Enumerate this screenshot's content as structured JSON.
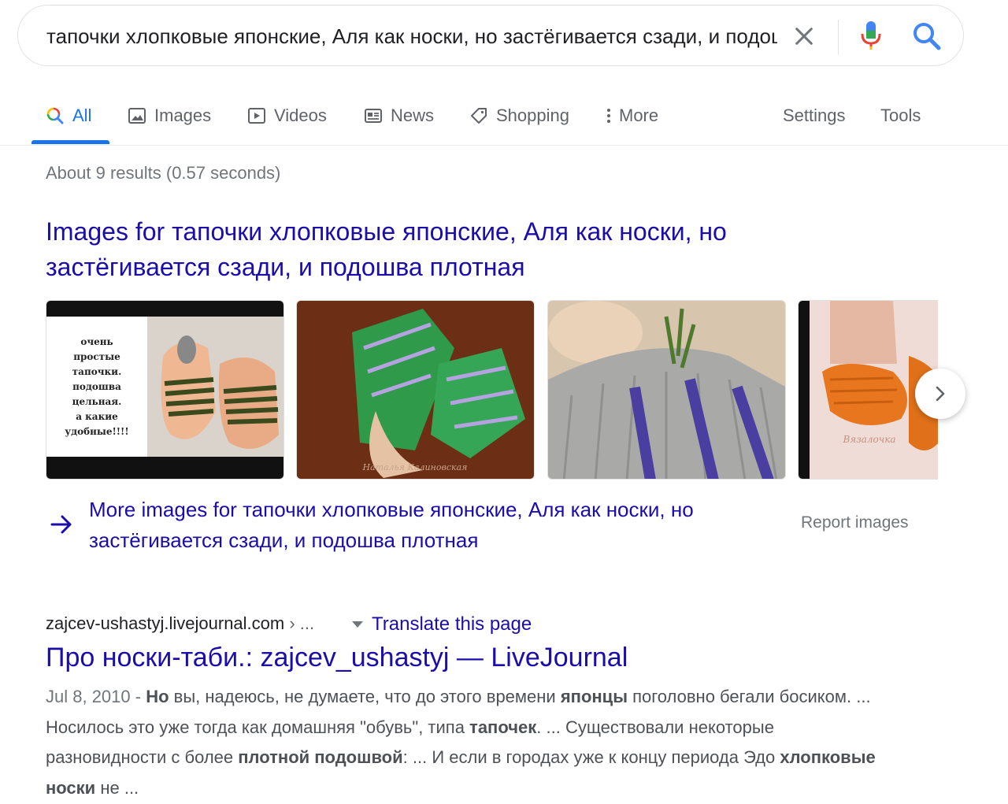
{
  "search": {
    "query": "тапочки хлопковые японские, Аля как носки, но застёгивается сзади, и подошва плотная"
  },
  "tabs": [
    {
      "label": "All",
      "icon": "search-multicolor-icon",
      "active": true
    },
    {
      "label": "Images",
      "icon": "image-icon"
    },
    {
      "label": "Videos",
      "icon": "play-icon"
    },
    {
      "label": "News",
      "icon": "newspaper-icon"
    },
    {
      "label": "Shopping",
      "icon": "tag-icon"
    },
    {
      "label": "More",
      "icon": "more-vertical-icon"
    },
    {
      "label": "Settings"
    },
    {
      "label": "Tools"
    }
  ],
  "stats": "About 9 results (0.57 seconds)",
  "images_section": {
    "title": "Images for тапочки хлопковые японские, Аля как носки, но застёгивается сзади, и подошва плотная",
    "thumb1_lines": [
      "очень",
      "простые",
      "тапочки.",
      "подошва",
      "цельная.",
      "а какие",
      "удобные!!!!"
    ],
    "thumb2_watermark": "Наталья Калиновская",
    "thumb4_watermark": "Вязалочка",
    "more_images": "More images for тапочки хлопковые японские, Аля как носки, но застёгивается сзади, и подошва плотная",
    "report": "Report images"
  },
  "result": {
    "domain": "zajcev-ushastyj.livejournal.com",
    "breadcrumb": " › ...",
    "translate": "Translate this page",
    "title": "Про носки-таби.: zajcev_ushastyj — LiveJournal",
    "date": "Jul 8, 2010 - ",
    "snippet": {
      "s1": "Но",
      "s2": " вы, надеюсь, не думаете, что до этого времени ",
      "s3": "японцы",
      "s4": " поголовно бегали босиком. ... Носилось это уже тогда как домашняя \"обувь\", типа ",
      "s5": "тапочек",
      "s6": ". ... Существовали некоторые разновидности с более ",
      "s7": "плотной подошвой",
      "s8": ": ... И если в городах уже к концу периода Эдо ",
      "s9": "хлопковые носки",
      "s10": " не ..."
    }
  },
  "colors": {
    "link": "#1a0dab",
    "accent": "#1a73e8",
    "muted": "#70757a"
  }
}
